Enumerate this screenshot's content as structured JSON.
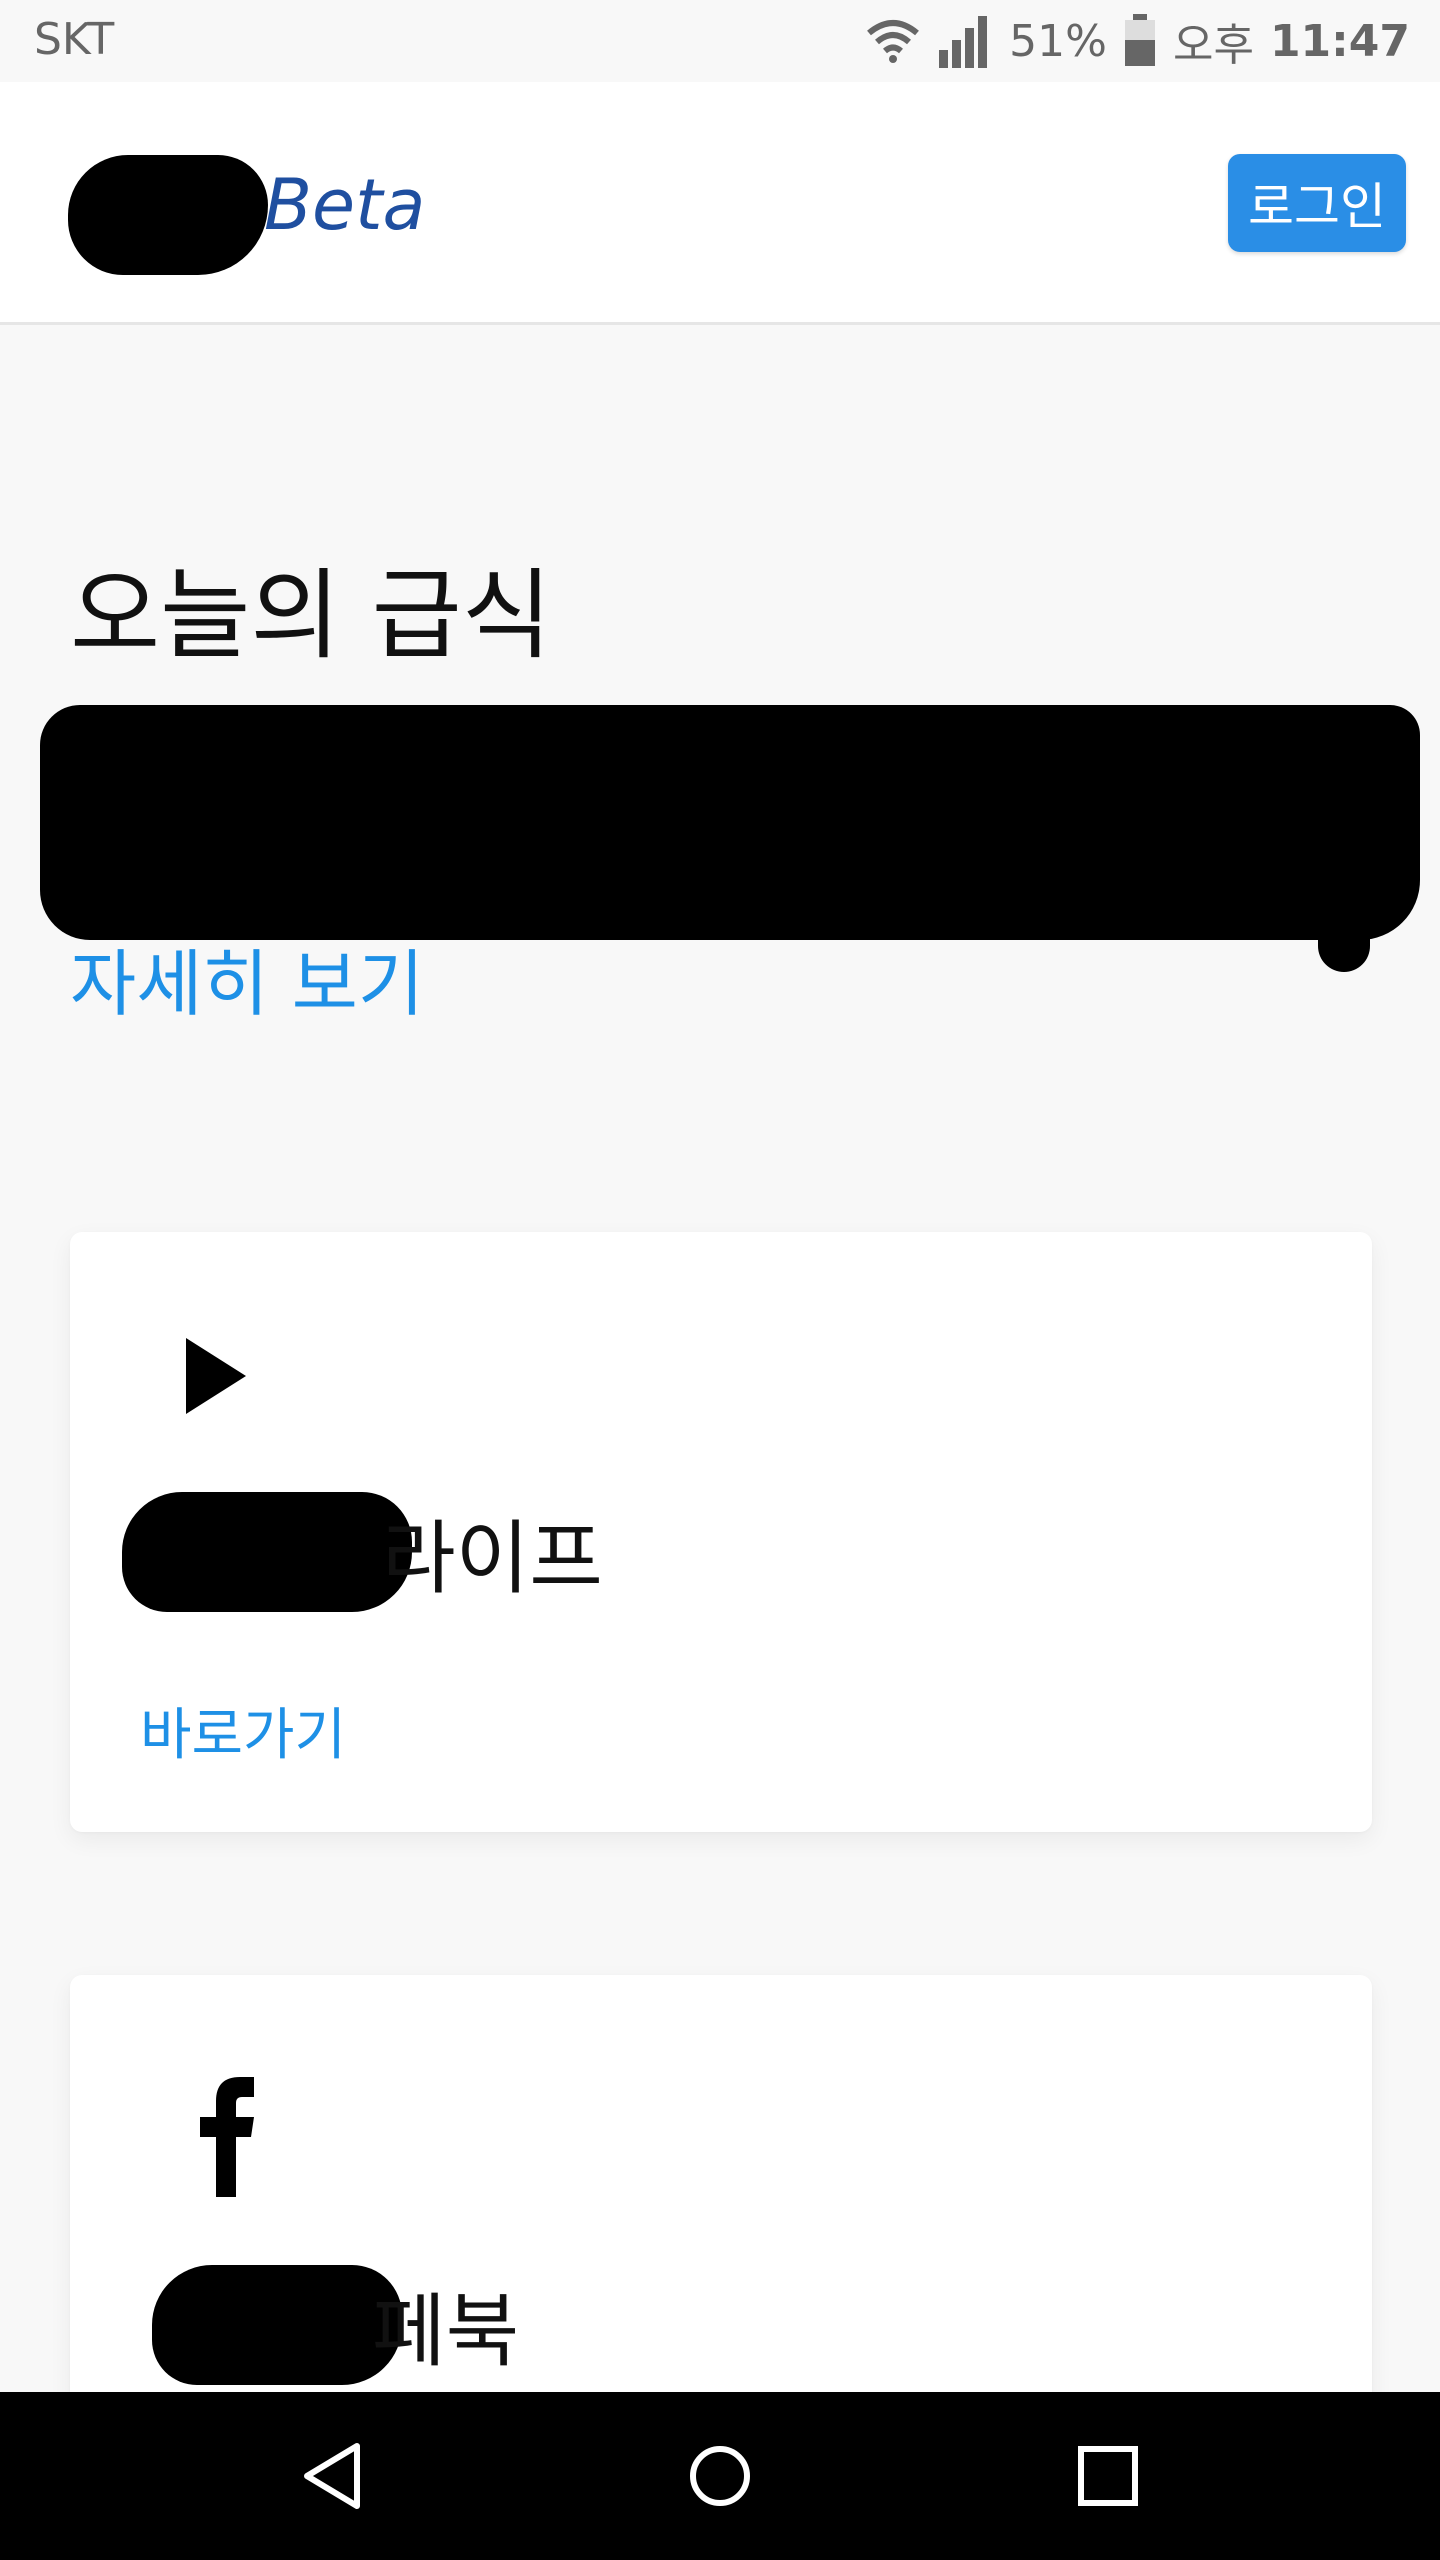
{
  "status_bar": {
    "carrier": "SKT",
    "battery_percent": "51%",
    "period": "오후",
    "time": "11:47",
    "icons": [
      "wifi-icon",
      "signal-icon",
      "battery-icon"
    ]
  },
  "header": {
    "brand_suffix": "Beta",
    "login_label": "로그인",
    "accent_color": "#2a8ee6"
  },
  "meal": {
    "title": "오늘의 급식",
    "detail_link": "자세히 보기"
  },
  "cards": [
    {
      "icon": "play-icon",
      "title_suffix": "라이프",
      "link": "바로가기"
    },
    {
      "icon": "facebook-icon",
      "title_suffix": "페북"
    }
  ],
  "nav": {
    "icons": [
      "back-icon",
      "home-icon",
      "recent-apps-icon"
    ]
  }
}
